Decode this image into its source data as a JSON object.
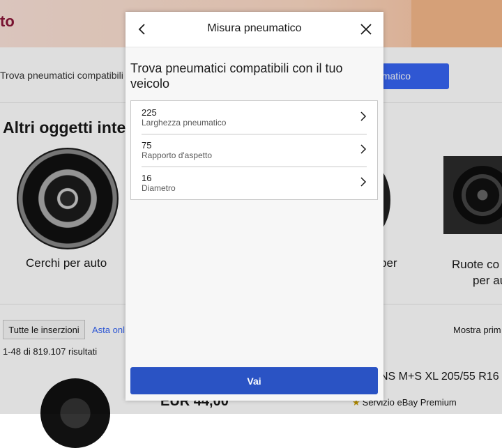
{
  "background": {
    "banner_title": "to",
    "finder_text": "Trova pneumatici compatibili",
    "finder_button": "umatico",
    "section_title": "Altri oggetti inte",
    "categories": [
      "Cerchi per auto",
      "per",
      "Ruote co",
      "per au"
    ],
    "tabs": {
      "all": "Tutte le inserzioni",
      "auction": "Asta onl"
    },
    "sort_label": "Mostra prim",
    "results_count": "1-48 di 819.107 risultati",
    "listing_title": "NS M+S XL 205/55 R16 9",
    "price": "EUR 44,00",
    "premium_label": "Servizio eBay Premium"
  },
  "modal": {
    "title": "Misura pneumatico",
    "heading": "Trova pneumatici compatibili con il tuo veicolo",
    "items": [
      {
        "value": "225",
        "label": "Larghezza pneumatico"
      },
      {
        "value": "75",
        "label": "Rapporto d'aspetto"
      },
      {
        "value": "16",
        "label": "Diametro"
      }
    ],
    "submit_label": "Vai"
  },
  "icons": {
    "back": "chevron-left-icon",
    "close": "close-icon",
    "row_chevron": "chevron-right-icon",
    "premium": "premium-badge-icon"
  },
  "colors": {
    "primary_button": "#2a53c4",
    "banner_accent": "#8a1538",
    "link": "#3665f3"
  }
}
